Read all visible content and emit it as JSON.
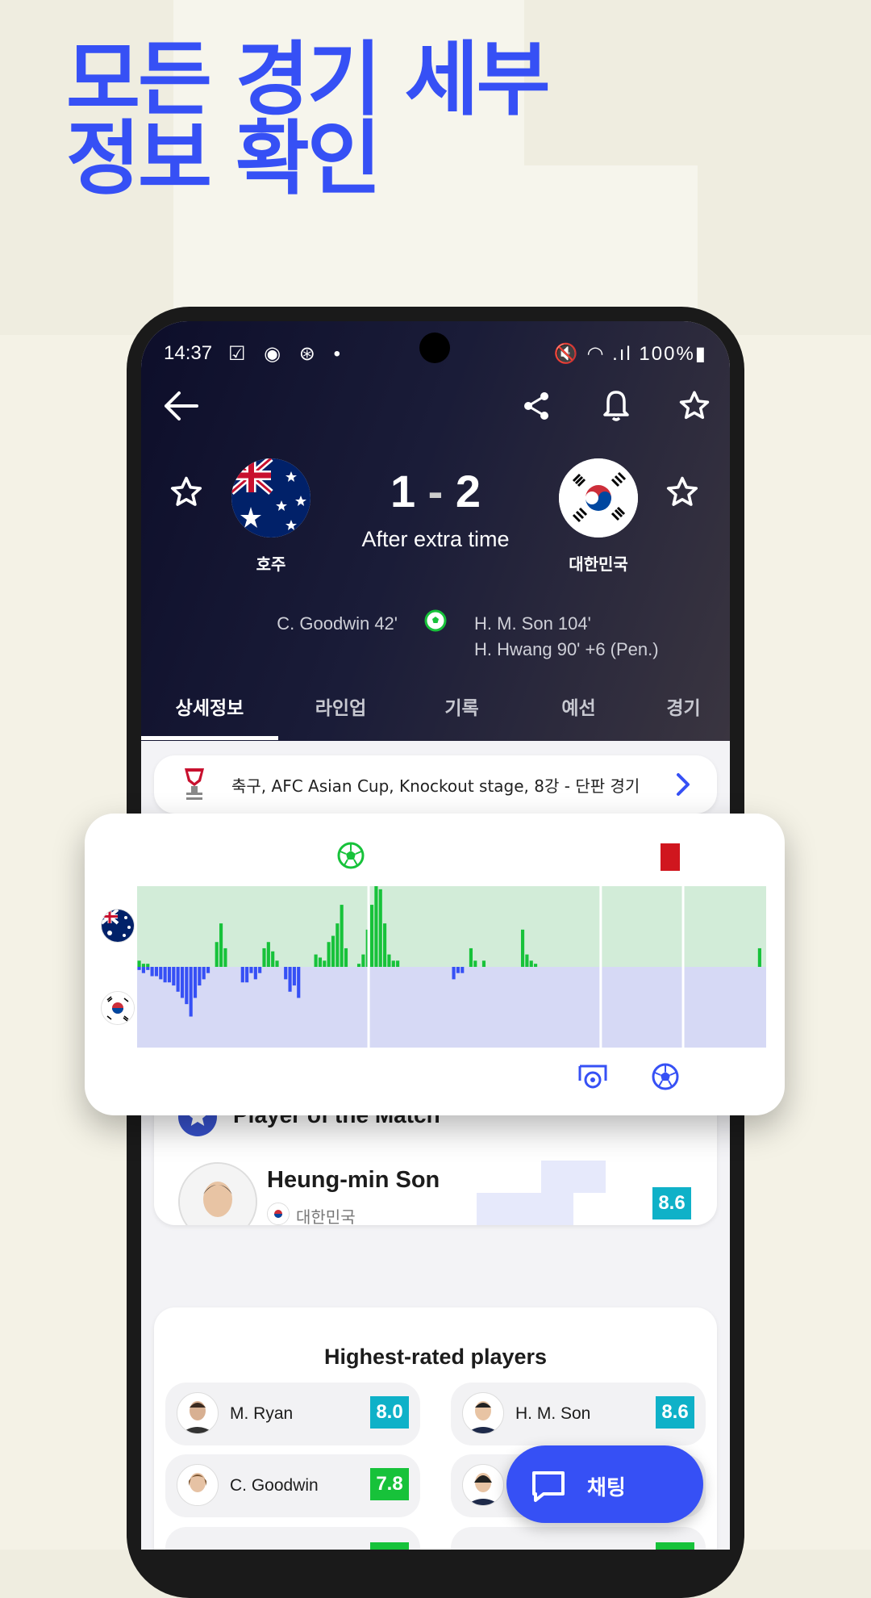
{
  "headline": {
    "line1": "모든 경기 세부",
    "line2": "정보 확인"
  },
  "status_bar": {
    "time": "14:37",
    "left_icons": "☑ ◉ ⊛ •",
    "right_icons": "🔇 ◠ .ıl 100%▮"
  },
  "match": {
    "home_team": "호주",
    "away_team": "대한민국",
    "home_score": "1",
    "separator": "-",
    "away_score": "2",
    "status": "After extra time",
    "home_scorers": [
      "C. Goodwin 42'"
    ],
    "away_scorers": [
      "H. M. Son 104'",
      "H. Hwang 90' +6 (Pen.)"
    ]
  },
  "tabs": [
    {
      "label": "상세정보",
      "active": true
    },
    {
      "label": "라인업",
      "active": false
    },
    {
      "label": "기록",
      "active": false
    },
    {
      "label": "예선",
      "active": false
    },
    {
      "label": "경기",
      "active": false
    }
  ],
  "competition": {
    "text": "축구, AFC Asian Cup, Knockout stage, 8강 - 단판 경기"
  },
  "momentum": {
    "home_color": "#17c23a",
    "away_color": "#3650f5",
    "home_bg": "#d2ecd8",
    "away_bg": "#d6d9f5",
    "home_values": [
      2,
      1,
      1,
      0,
      0,
      0,
      0,
      0,
      0,
      0,
      0,
      0,
      0,
      0,
      0,
      0,
      0,
      0,
      8,
      14,
      6,
      0,
      0,
      0,
      0,
      0,
      0,
      0,
      0,
      6,
      8,
      5,
      2,
      0,
      0,
      0,
      0,
      0,
      0,
      0,
      0,
      4,
      3,
      2,
      8,
      10,
      14,
      20,
      6,
      0,
      0,
      1,
      4,
      12,
      20,
      26,
      25,
      14,
      4,
      2,
      2,
      0,
      0,
      0,
      0,
      0,
      0,
      0,
      0,
      0,
      0,
      0,
      0,
      0,
      0,
      0,
      0,
      6,
      2,
      0,
      2,
      0,
      0,
      0,
      0,
      0,
      0,
      0,
      0,
      12,
      4,
      2,
      1,
      0,
      0,
      0,
      0,
      0,
      0,
      0,
      0,
      0,
      0,
      0,
      0,
      0,
      0,
      0,
      0,
      0,
      0,
      0,
      0,
      0,
      0,
      0,
      0,
      0,
      0,
      0,
      0,
      0,
      0,
      0,
      0,
      0,
      0,
      0,
      0,
      0,
      0,
      0,
      0,
      0,
      0,
      0,
      0,
      0,
      0,
      0,
      0,
      0,
      0,
      0,
      6,
      0
    ],
    "away_values": [
      1,
      2,
      1,
      3,
      3,
      4,
      5,
      5,
      6,
      8,
      10,
      12,
      16,
      10,
      6,
      4,
      2,
      0,
      0,
      0,
      0,
      0,
      0,
      0,
      5,
      5,
      2,
      4,
      2,
      0,
      0,
      0,
      0,
      0,
      4,
      8,
      6,
      10,
      0,
      0,
      0,
      0,
      0,
      0,
      0,
      0,
      0,
      0,
      0,
      0,
      0,
      0,
      0,
      0,
      0,
      0,
      0,
      0,
      0,
      0,
      0,
      0,
      0,
      0,
      0,
      0,
      0,
      0,
      0,
      0,
      0,
      0,
      0,
      4,
      2,
      2,
      0,
      0,
      0,
      0,
      0,
      0,
      0,
      0,
      0,
      0,
      0,
      0,
      0,
      0,
      0,
      0,
      0,
      0,
      0,
      0,
      0,
      0,
      0,
      0,
      0,
      0,
      0,
      0,
      0,
      0,
      0,
      0,
      0,
      0,
      0,
      0,
      0,
      0,
      0,
      0,
      0,
      0,
      0,
      0,
      0,
      0,
      0,
      0,
      0,
      0,
      0,
      0,
      0,
      0,
      0,
      0,
      0,
      0,
      0,
      0,
      0,
      0,
      0,
      0,
      0,
      0,
      0,
      0,
      0,
      0
    ],
    "period_breaks_fraction": [
      0.368,
      0.737,
      0.868
    ]
  },
  "potm": {
    "title": "Player of the Match",
    "name": "Heung-min Son",
    "country": "대한민국",
    "rating": "8.6"
  },
  "highest_rated": {
    "title": "Highest-rated players",
    "players": [
      {
        "name": "M. Ryan",
        "rating": "8.0",
        "color": "teal"
      },
      {
        "name": "H. M. Son",
        "rating": "8.6",
        "color": "teal"
      },
      {
        "name": "C. Goodwin",
        "rating": "7.8",
        "color": "green"
      },
      {
        "name": "",
        "rating": "",
        "color": ""
      }
    ]
  },
  "chat": {
    "label": "채팅"
  },
  "icons": [
    "back-arrow-icon",
    "share-icon",
    "bell-icon",
    "star-icon",
    "soccer-ball-icon",
    "red-card-icon",
    "goal-post-icon",
    "chevron-right-icon",
    "chat-icon"
  ]
}
